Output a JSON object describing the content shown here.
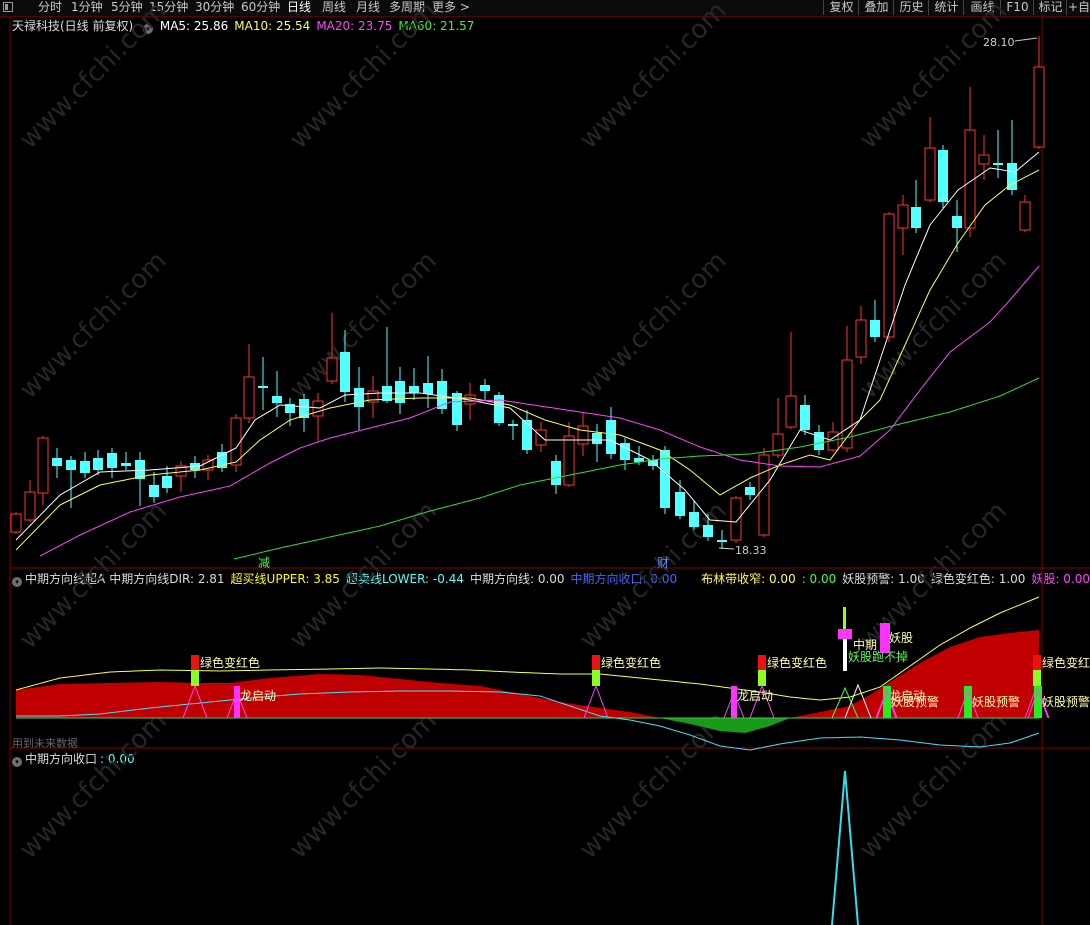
{
  "toolbar": {
    "tabs": [
      {
        "label": "分时"
      },
      {
        "label": "1分钟"
      },
      {
        "label": "5分钟"
      },
      {
        "label": "15分钟"
      },
      {
        "label": "30分钟"
      },
      {
        "label": "60分钟"
      },
      {
        "label": "日线"
      },
      {
        "label": "周线"
      },
      {
        "label": "月线"
      },
      {
        "label": "多周期"
      },
      {
        "label": "更多 >"
      }
    ],
    "active_tab": "日线",
    "right_buttons": [
      {
        "label": "复权"
      },
      {
        "label": "叠加"
      },
      {
        "label": "历史"
      },
      {
        "label": "统计"
      },
      {
        "label": "画线"
      },
      {
        "label": "F10"
      },
      {
        "label": "标记"
      },
      {
        "label": "+自"
      }
    ]
  },
  "main_chart": {
    "title": "天禄科技(日线 前复权)",
    "ma": [
      {
        "label": "MA5: 25.86",
        "color": "#ffffff"
      },
      {
        "label": "MA10: 25.54",
        "color": "#ffff55"
      },
      {
        "label": "MA20: 23.75",
        "color": "#ff44ff"
      },
      {
        "label": "MA60: 21.57",
        "color": "#44ee44"
      }
    ],
    "high_label": "28.10",
    "low_label": "18.33",
    "mark_jian": "减",
    "mark_cai": "财"
  },
  "indicator_1": {
    "name": "中期方向线超A",
    "items": [
      {
        "label": "中期方向线DIR: 2.81",
        "color": "#dddddd"
      },
      {
        "label": "超买线UPPER: 3.85",
        "color": "#ffff00"
      },
      {
        "label": "超卖线LOWER: -0.44",
        "color": "#55ffff"
      },
      {
        "label": "中期方向线: 0.00",
        "color": "#dddddd"
      },
      {
        "label": "中期方向收口: 0.00",
        "color": "#4466ff"
      },
      {
        "label": "布林带收窄: 0.00",
        "color": "#ffff55"
      },
      {
        "label": ": 0.00",
        "color": "#44ff44"
      },
      {
        "label": "妖股预警: 1.00",
        "color": "#dddddd"
      },
      {
        "label": "绿色变红色: 1.00",
        "color": "#dddddd"
      },
      {
        "label": "妖股: 0.00",
        "color": "#ff44ff"
      }
    ],
    "annotations": {
      "green_to_red": "绿色变红色",
      "green_to_red_short": "绿色变红",
      "dragon_start": "龙启动",
      "demon_warning": "妖股预警",
      "demon": "妖股",
      "mid_term": "中期",
      "demon_no_fall": "妖股跑不掉"
    },
    "future_note": "用到未来数据"
  },
  "indicator_2": {
    "name": "中期方向收口",
    "value": ": 0.00"
  },
  "watermark": "www.cfchi.com",
  "colors": {
    "up_candle": "#ff3333",
    "down_candle": "#54ffff",
    "fill_red": "#c00000",
    "fill_green": "#1a9a1a",
    "yellow": "#ffff44",
    "cyan": "#44e0ff",
    "ma5": "#ffffff",
    "ma10": "#ffff55",
    "ma20": "#ff44ff",
    "ma60": "#33dd33"
  }
}
